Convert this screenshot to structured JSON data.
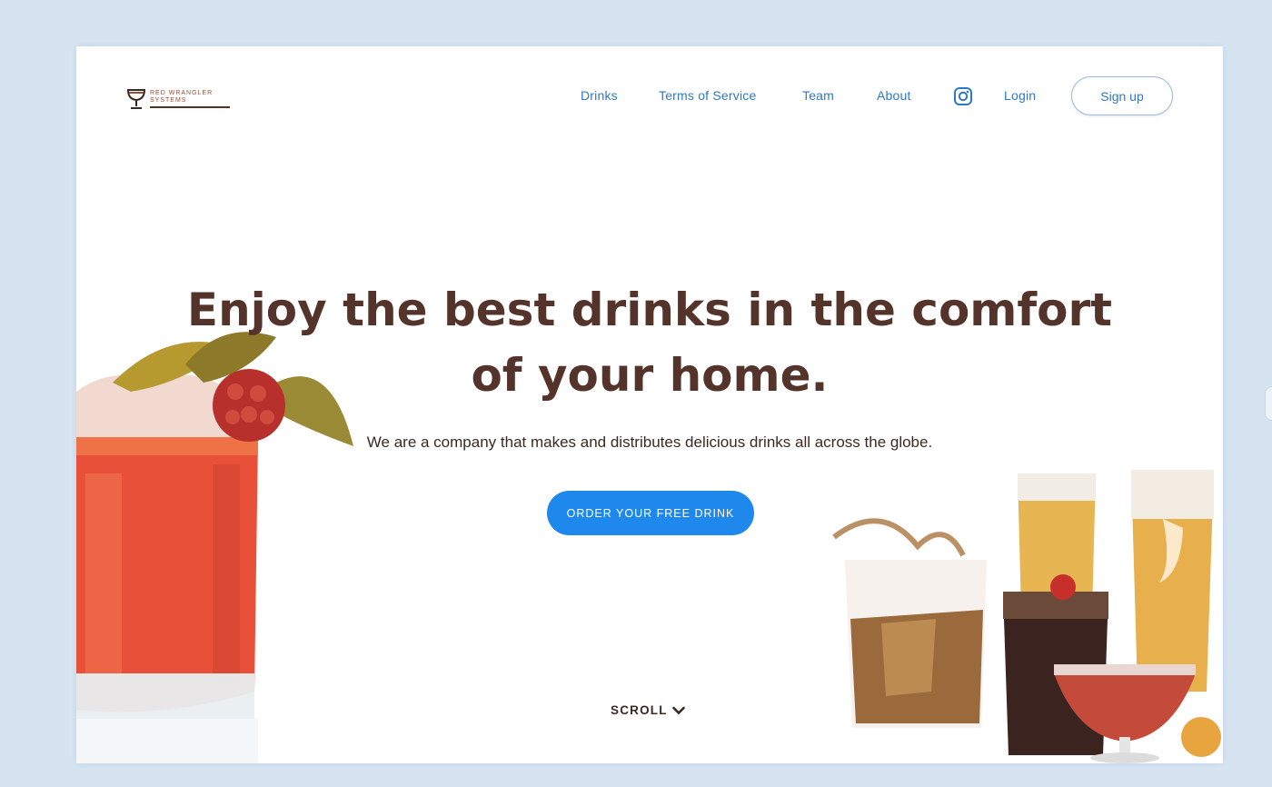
{
  "brand": {
    "logo_lines": [
      "RED WRANGLER",
      "SYSTEMS"
    ]
  },
  "nav": {
    "links": [
      "Drinks",
      "Terms of Service",
      "Team",
      "About"
    ],
    "instagram_icon": "instagram-icon",
    "login": "Login",
    "signup": "Sign up"
  },
  "hero": {
    "title_line1": "Enjoy the best drinks in the comfort",
    "title_line2": "of your home.",
    "subtitle": "We are a company that makes and distributes delicious drinks all across the globe.",
    "cta": "ORDER YOUR FREE DRINK",
    "scroll": "SCROLL",
    "scroll_icon": "chevron-down-icon"
  },
  "colors": {
    "page_bg": "#d6e4f2",
    "link": "#2f78c4",
    "title": "#54342a",
    "cta_bg": "#1e88ec"
  }
}
